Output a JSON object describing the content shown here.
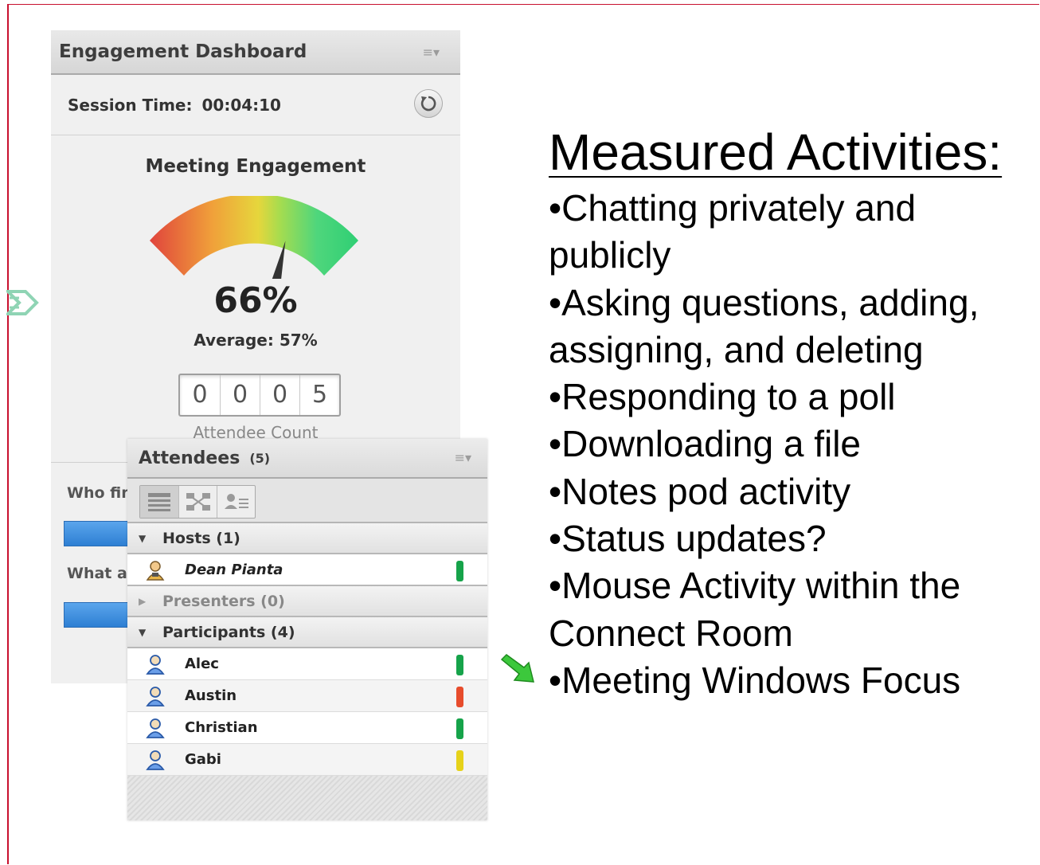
{
  "engagement_pod": {
    "title": "Engagement Dashboard",
    "menu_icon": "menu-icon",
    "session_label": "Session Time:",
    "session_time": "00:04:10",
    "refresh_icon": "refresh-icon",
    "meeting_title": "Meeting Engagement",
    "gauge_value": "66%",
    "gauge_level": 0.66,
    "average": "Average: 57%",
    "attendee_count_digits": [
      "0",
      "0",
      "0",
      "5"
    ],
    "attendee_count_label": "Attendee Count",
    "question_1": "Who fin",
    "question_2": "What ar"
  },
  "attendees_pod": {
    "title": "Attendees",
    "count": "(5)",
    "menu_icon": "menu-icon",
    "view_buttons": [
      "list-view-icon",
      "breakout-view-icon",
      "status-view-icon"
    ],
    "groups": {
      "hosts": "Hosts (1)",
      "presenters": "Presenters (0)",
      "participants": "Participants (4)"
    },
    "host": {
      "name": "Dean Pianta",
      "status": "green"
    },
    "participants": [
      {
        "name": "Alec",
        "status": "green"
      },
      {
        "name": "Austin",
        "status": "red"
      },
      {
        "name": "Christian",
        "status": "green"
      },
      {
        "name": "Gabi",
        "status": "yellow"
      }
    ]
  },
  "status_colors": {
    "green": "#16a34a",
    "red": "#e74c2c",
    "yellow": "#e6d21a"
  },
  "slide": {
    "heading": "Measured Activities:",
    "bullets": [
      "•Chatting privately and publicly",
      "•Asking questions, adding, assigning, and deleting",
      "•Responding to a poll",
      "•Downloading a file",
      "•Notes pod activity",
      "•Status updates?",
      "•Mouse Activity within the Connect Room",
      "•Meeting Windows Focus"
    ]
  }
}
